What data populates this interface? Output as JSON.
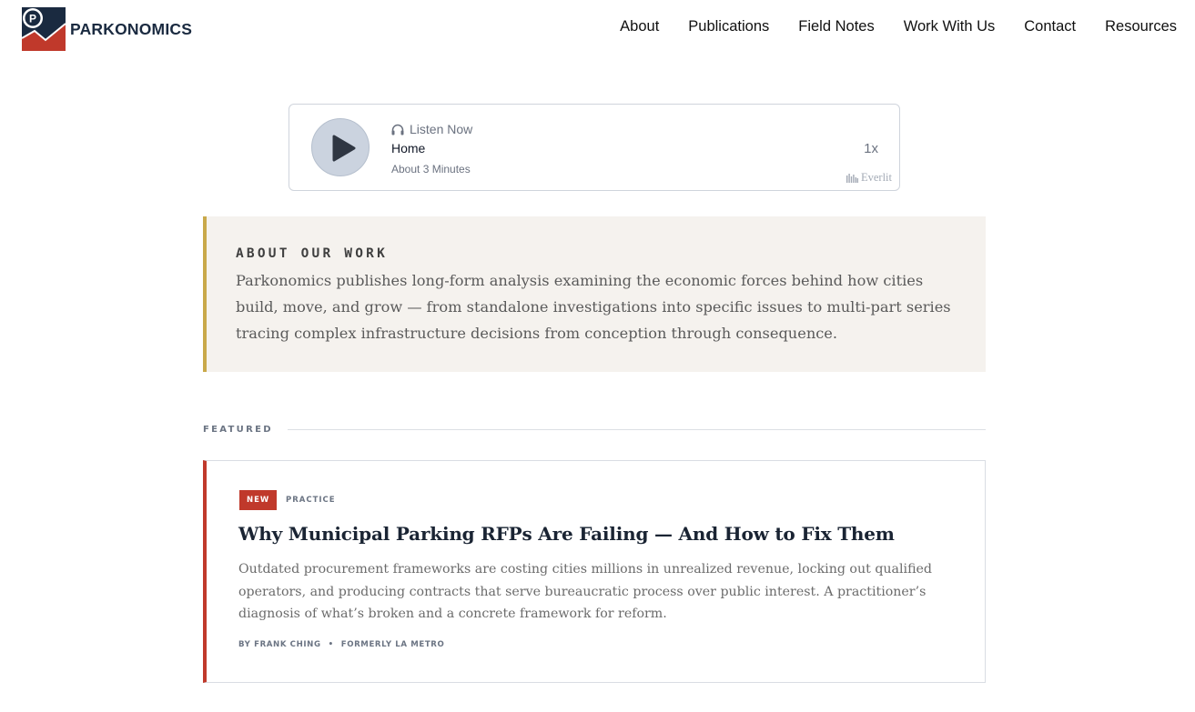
{
  "brand": {
    "name": "PARKONOMICS"
  },
  "nav": {
    "items": [
      {
        "label": "About"
      },
      {
        "label": "Publications"
      },
      {
        "label": "Field Notes"
      },
      {
        "label": "Work With Us"
      },
      {
        "label": "Contact"
      },
      {
        "label": "Resources"
      }
    ]
  },
  "player": {
    "listen_label": "Listen Now",
    "title": "Home",
    "duration": "About 3 Minutes",
    "speed": "1x",
    "provider": "Everlit",
    "icons": {
      "play": "play-icon",
      "listen": "headphones-icon",
      "provider": "bars-icon"
    }
  },
  "about": {
    "heading": "ABOUT OUR WORK",
    "body": "Parkonomics publishes long-form analysis examining the economic forces behind how cities build, move, and grow — from standalone investigations into specific issues to multi-part series tracing complex infrastructure decisions from conception through consequence."
  },
  "featured": {
    "label": "FEATURED",
    "card": {
      "badge": "NEW",
      "category": "PRACTICE",
      "title": "Why Municipal Parking RFPs Are Failing — And How to Fix Them",
      "description": "Outdated procurement frameworks are costing cities millions in unrealized revenue, locking out qualified operators, and producing contracts that serve bureaucratic process over public interest. A practitioner’s diagnosis of what’s broken and a concrete framework for reform.",
      "author": "BY FRANK CHING",
      "separator": "•",
      "affiliation": "FORMERLY LA METRO"
    }
  },
  "colors": {
    "accent_red": "#c0392b",
    "accent_gold": "#c9a94a",
    "navy": "#1a2a40",
    "about_bg": "#f5f2ee"
  }
}
